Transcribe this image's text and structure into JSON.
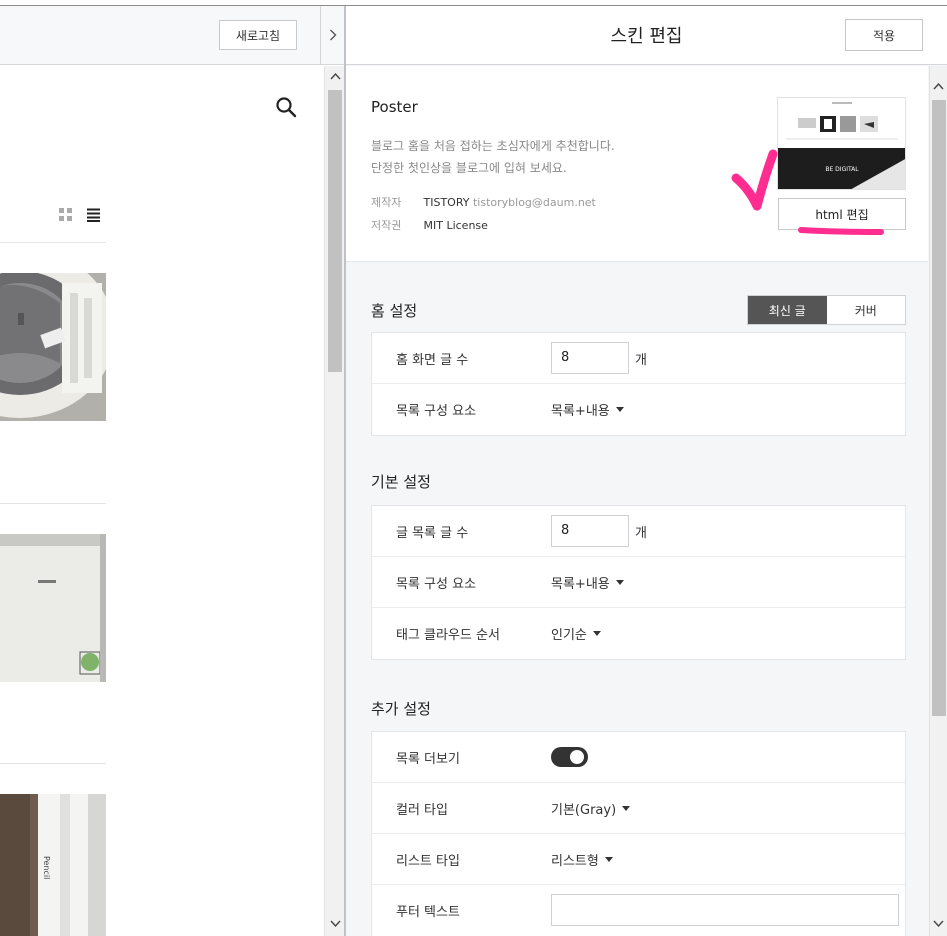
{
  "left_pane": {
    "refresh_label": "새로고침",
    "collapse_icon": "chevron-right-icon"
  },
  "right_pane": {
    "title": "스킨 편집",
    "apply_label": "적용",
    "skin": {
      "name": "Poster",
      "description_line1": "블로그 홈을 처음 접하는 초심자에게 추천합니다.",
      "description_line2": "단정한 첫인상을 블로그에 입혀 보세요.",
      "author_key": "제작자",
      "author_name": "TISTORY",
      "author_email": "tistoryblog@daum.net",
      "license_key": "저작권",
      "license_value": "MIT License",
      "thumbnail_text": "BE DIGITAL",
      "html_edit_label": "html 편집"
    },
    "home_settings": {
      "title": "홈 설정",
      "tabs": [
        "최신 글",
        "커버"
      ],
      "active_tab": "최신 글",
      "rows": [
        {
          "label": "홈 화면 글 수",
          "value": "8",
          "unit": "개"
        },
        {
          "label": "목록 구성 요소",
          "value": "목록+내용"
        }
      ]
    },
    "basic_settings": {
      "title": "기본 설정",
      "rows": [
        {
          "label": "글 목록 글 수",
          "value": "8",
          "unit": "개"
        },
        {
          "label": "목록 구성 요소",
          "value": "목록+내용"
        },
        {
          "label": "태그 클라우드 순서",
          "value": "인기순"
        }
      ]
    },
    "extra_settings": {
      "title": "추가 설정",
      "rows": [
        {
          "label": "목록 더보기",
          "value": "on"
        },
        {
          "label": "컬러 타입",
          "value": "기본(Gray)"
        },
        {
          "label": "리스트 타입",
          "value": "리스트형"
        },
        {
          "label": "푸터 텍스트",
          "value": ""
        }
      ]
    }
  },
  "colors": {
    "annotation": "#ff2d8f",
    "toggle_on": "#333333",
    "active_tab": "#555555"
  }
}
